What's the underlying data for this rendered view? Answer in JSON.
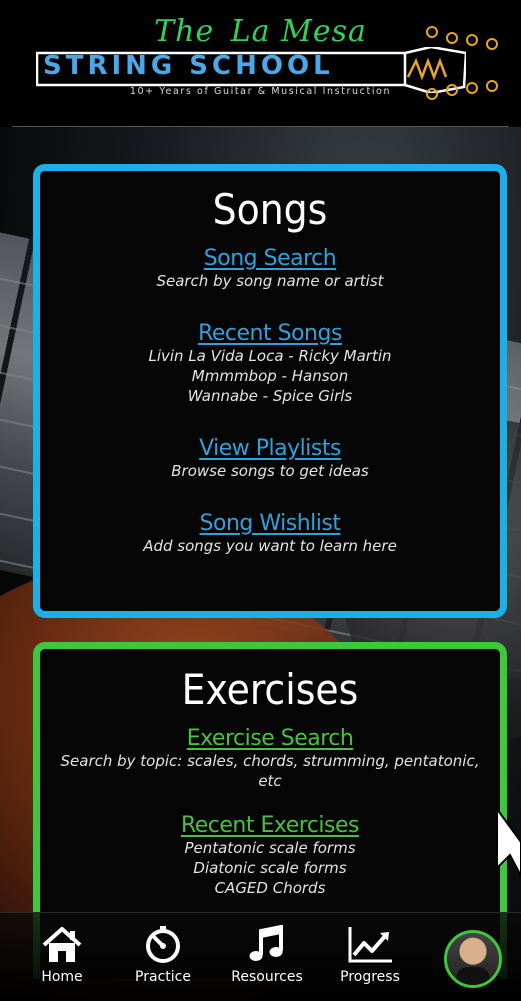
{
  "logo": {
    "script_line": [
      "The",
      "La",
      "Mesa"
    ],
    "main": "STRING SCHOOL",
    "tagline": "10+ Years of Guitar & Musical Instruction"
  },
  "songs": {
    "title": "Songs",
    "search": {
      "link": "Song Search",
      "desc": "Search by song name or artist"
    },
    "recent": {
      "link": "Recent Songs",
      "items": [
        "Livin La Vida Loca - Ricky Martin",
        "Mmmmbop - Hanson",
        "Wannabe - Spice Girls"
      ]
    },
    "playlists": {
      "link": "View Playlists",
      "desc": "Browse songs to get ideas"
    },
    "wishlist": {
      "link": "Song Wishlist",
      "desc": "Add songs you want to learn here"
    }
  },
  "exercises": {
    "title": "Exercises",
    "search": {
      "link": "Exercise Search",
      "desc": "Search by topic: scales, chords, strumming, pentatonic, etc"
    },
    "recent": {
      "link": "Recent Exercises",
      "items": [
        "Pentatonic scale forms",
        "Diatonic scale forms",
        "CAGED Chords"
      ]
    }
  },
  "nav": {
    "items": [
      {
        "label": "Home",
        "icon": "home-icon"
      },
      {
        "label": "Practice",
        "icon": "timer-icon"
      },
      {
        "label": "Resources",
        "icon": "music-note-icon"
      },
      {
        "label": "Progress",
        "icon": "chart-icon"
      }
    ],
    "profile_icon": "avatar"
  },
  "colors": {
    "songs_accent": "#1cb0e6",
    "exercises_accent": "#3ec63c",
    "logo_green": "#2fd35a",
    "logo_blue": "#4aa8e8"
  }
}
